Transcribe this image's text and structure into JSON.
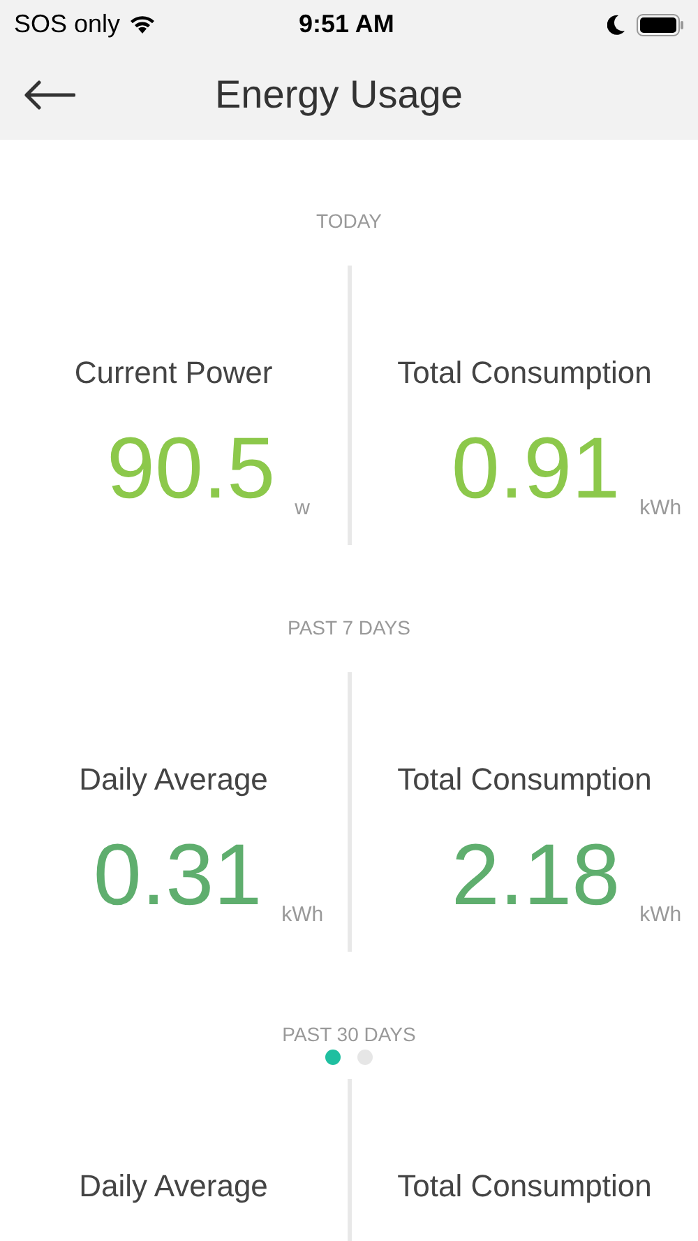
{
  "status_bar": {
    "carrier": "SOS only",
    "time": "9:51 AM"
  },
  "header": {
    "title": "Energy Usage"
  },
  "sections": [
    {
      "label": "TODAY",
      "metrics": [
        {
          "label": "Current Power",
          "value": "90.5",
          "unit": "w",
          "color": "#8cc84b"
        },
        {
          "label": "Total Consumption",
          "value": "0.91",
          "unit": "kWh",
          "color": "#8cc84b"
        }
      ]
    },
    {
      "label": "PAST 7 DAYS",
      "metrics": [
        {
          "label": "Daily Average",
          "value": "0.31",
          "unit": "kWh",
          "color": "#5fae6e"
        },
        {
          "label": "Total Consumption",
          "value": "2.18",
          "unit": "kWh",
          "color": "#5fae6e"
        }
      ]
    },
    {
      "label": "PAST 30 DAYS",
      "metrics": [
        {
          "label": "Daily Average"
        },
        {
          "label": "Total Consumption"
        }
      ]
    }
  ],
  "pager": [
    {
      "selected": true
    },
    {
      "selected": false
    }
  ]
}
